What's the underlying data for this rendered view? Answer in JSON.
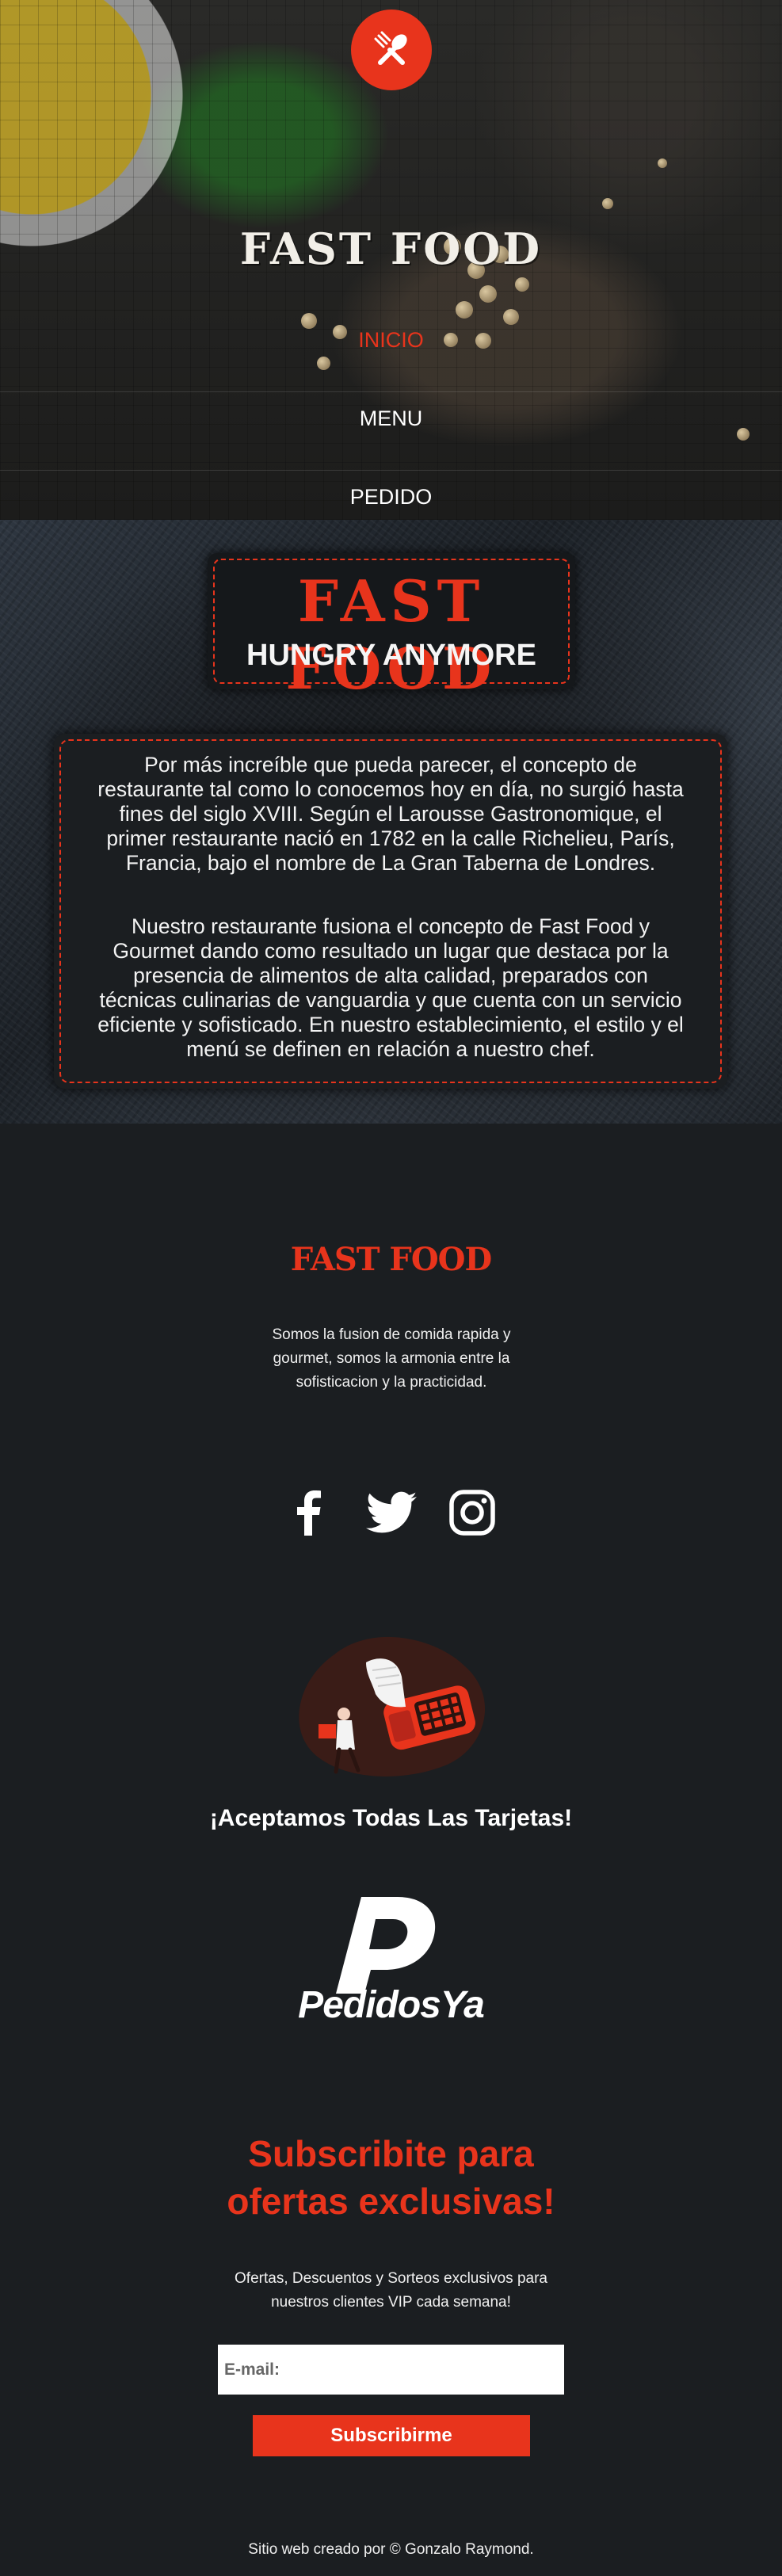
{
  "header": {
    "logo_icon": "fork-spoon-icon",
    "title": "FAST FOOD",
    "nav": [
      {
        "label": "INICIO",
        "active": true
      },
      {
        "label": "MENU",
        "active": false
      },
      {
        "label": "PEDIDO",
        "active": false
      }
    ]
  },
  "about": {
    "brand_name": "FAST FOOD",
    "tagline": "HUNGRY ANYMORE",
    "paragraphs": [
      [
        "Por más increíble que pueda parecer, el concepto de",
        "restaurante tal como lo conocemos hoy en día, no surgió hasta",
        "fines del siglo XVIII. Según el Larousse Gastronomique, el",
        "primer restaurante nació en 1782 en la calle Richelieu, París,",
        "Francia, bajo el nombre de La Gran Taberna de Londres."
      ],
      [
        "Nuestro restaurante fusiona el concepto de Fast Food y",
        "Gourmet dando como resultado un lugar que destaca por la",
        "presencia de alimentos de alta calidad, preparados con",
        "técnicas culinarias de vanguardia y que cuenta con un servicio",
        "eficiente y sofisticado. En nuestro establecimiento, el estilo y el",
        "menú se definen en relación a nuestro chef."
      ]
    ]
  },
  "footer": {
    "brand": "FAST FOOD",
    "description": [
      "Somos la fusion de comida rapida y",
      "gourmet, somos la armonia entre la",
      "sofisticacion y la practicidad."
    ],
    "socials": [
      {
        "name": "facebook",
        "icon": "facebook-icon"
      },
      {
        "name": "twitter",
        "icon": "twitter-icon"
      },
      {
        "name": "instagram",
        "icon": "instagram-icon"
      }
    ],
    "cards_text": "¡Aceptamos Todas Las Tarjetas!",
    "delivery_partner": "PedidosYa",
    "subscribe": {
      "title": [
        "Subscribite para",
        "ofertas exclusivas!"
      ],
      "description": [
        "Ofertas, Descuentos y Sorteos exclusivos para",
        "nuestros clientes VIP cada semana!"
      ],
      "email_placeholder": "E-mail:",
      "button": "Subscribirme"
    },
    "credit": "Sitio web creado por © Gonzalo Raymond."
  },
  "colors": {
    "accent": "#e8341c",
    "background": "#1b1e21",
    "text": "#ffffff"
  }
}
